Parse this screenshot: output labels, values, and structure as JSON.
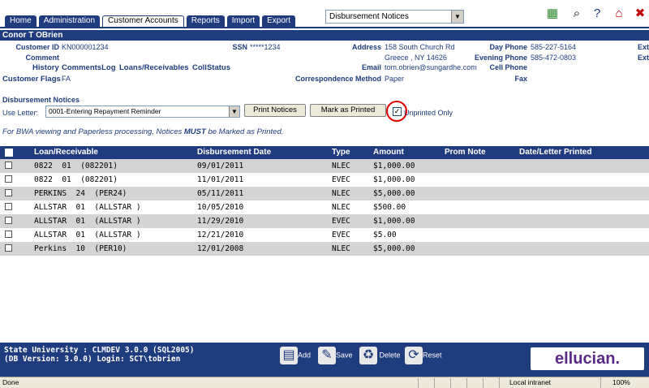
{
  "nav": {
    "tabs": [
      "Home",
      "Administration",
      "Customer Accounts",
      "Reports",
      "Import",
      "Export"
    ],
    "active_tab": "Customer Accounts",
    "form_select": "Disbursement Notices"
  },
  "toolbar_icons": [
    "network-icon",
    "binoculars-icon",
    "help-icon",
    "home-icon",
    "close-icon"
  ],
  "customer": {
    "name": "Conor T OBrien",
    "customer_id_label": "Customer ID",
    "customer_id": "KN000001234",
    "ssn_label": "SSN",
    "ssn": "*****1234",
    "address_label": "Address",
    "address_line1": "158 South Church Rd",
    "address_line2": "Greece , NY 14626",
    "day_phone_label": "Day Phone",
    "day_phone": "585-227-5164",
    "evening_phone_label": "Evening Phone",
    "evening_phone": "585-472-0803",
    "cell_phone_label": "Cell Phone",
    "fax_label": "Fax",
    "ext_label": "Ext",
    "comment_label": "Comment",
    "email_label": "Email",
    "email": "tom.obrien@sungardhe.com",
    "correspondence_label": "Correspondence Method",
    "correspondence": "Paper",
    "flags_label": "Customer Flags",
    "flags": "FA",
    "links": [
      "History",
      "CommentsLog",
      "Loans/Receivables",
      "CollStatus"
    ]
  },
  "disbursement": {
    "section_title": "Disbursement Notices",
    "use_letter_label": "Use Letter:",
    "letter_value": "0001-Entering Repayment Reminder",
    "print_button": "Print Notices",
    "mark_button": "Mark as Printed",
    "unprinted_label": "Unprinted Only",
    "unprinted_checked": true,
    "note_prefix": "For BWA viewing and Paperless processing, Notices ",
    "note_emphasis": "MUST",
    "note_suffix": " be Marked as Printed."
  },
  "table": {
    "headers": [
      "Loan/Receivable",
      "Disbursement Date",
      "Type",
      "Amount",
      "Prom Note",
      "Date/Letter Printed"
    ],
    "rows": [
      {
        "loan": "0822  01  (082201)",
        "date": "09/01/2011",
        "type": "NLEC",
        "amount": "$1,000.00"
      },
      {
        "loan": "0822  01  (082201)",
        "date": "11/01/2011",
        "type": "EVEC",
        "amount": "$1,000.00"
      },
      {
        "loan": "PERKINS  24  (PER24)",
        "date": "05/11/2011",
        "type": "NLEC",
        "amount": "$5,000.00"
      },
      {
        "loan": "ALLSTAR  01  (ALLSTAR )",
        "date": "10/05/2010",
        "type": "NLEC",
        "amount": "$500.00"
      },
      {
        "loan": "ALLSTAR  01  (ALLSTAR )",
        "date": "11/29/2010",
        "type": "EVEC",
        "amount": "$1,000.00"
      },
      {
        "loan": "ALLSTAR  01  (ALLSTAR )",
        "date": "12/21/2010",
        "type": "EVEC",
        "amount": "$5.00"
      },
      {
        "loan": "Perkins  10  (PER10)",
        "date": "12/01/2008",
        "type": "NLEC",
        "amount": "$5,000.00"
      }
    ]
  },
  "footer": {
    "line1": "State University : CLMDEV 3.0.0 (SQL2005)",
    "line2": "(DB Version: 3.0.0) Login: SCT\\tobrien",
    "add_label": "Add",
    "save_label": "Save",
    "delete_label": "Delete",
    "reset_label": "Reset",
    "logo_text": "ellucian."
  },
  "statusbar": {
    "status": "Done",
    "zone": "Local intranet",
    "zoom": "100%"
  }
}
